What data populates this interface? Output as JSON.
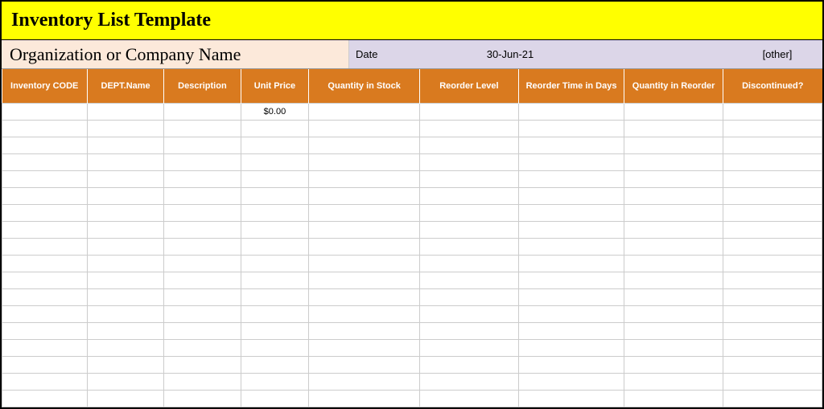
{
  "title": "Inventory List Template",
  "info": {
    "org_label": "Organization  or Company Name",
    "date_label": "Date",
    "date_value": "30-Jun-21",
    "other": "[other]"
  },
  "columns": [
    "Inventory CODE",
    "DEPT.Name",
    "Description",
    "Unit Price",
    "Quantity in Stock",
    "Reorder Level",
    "Reorder Time in Days",
    "Quantity in Reorder",
    "Discontinued?"
  ],
  "rows": [
    [
      "",
      "",
      "",
      "$0.00",
      "",
      "",
      "",
      "",
      ""
    ],
    [
      "",
      "",
      "",
      "",
      "",
      "",
      "",
      "",
      ""
    ],
    [
      "",
      "",
      "",
      "",
      "",
      "",
      "",
      "",
      ""
    ],
    [
      "",
      "",
      "",
      "",
      "",
      "",
      "",
      "",
      ""
    ],
    [
      "",
      "",
      "",
      "",
      "",
      "",
      "",
      "",
      ""
    ],
    [
      "",
      "",
      "",
      "",
      "",
      "",
      "",
      "",
      ""
    ],
    [
      "",
      "",
      "",
      "",
      "",
      "",
      "",
      "",
      ""
    ],
    [
      "",
      "",
      "",
      "",
      "",
      "",
      "",
      "",
      ""
    ],
    [
      "",
      "",
      "",
      "",
      "",
      "",
      "",
      "",
      ""
    ],
    [
      "",
      "",
      "",
      "",
      "",
      "",
      "",
      "",
      ""
    ],
    [
      "",
      "",
      "",
      "",
      "",
      "",
      "",
      "",
      ""
    ],
    [
      "",
      "",
      "",
      "",
      "",
      "",
      "",
      "",
      ""
    ],
    [
      "",
      "",
      "",
      "",
      "",
      "",
      "",
      "",
      ""
    ],
    [
      "",
      "",
      "",
      "",
      "",
      "",
      "",
      "",
      ""
    ],
    [
      "",
      "",
      "",
      "",
      "",
      "",
      "",
      "",
      ""
    ],
    [
      "",
      "",
      "",
      "",
      "",
      "",
      "",
      "",
      ""
    ],
    [
      "",
      "",
      "",
      "",
      "",
      "",
      "",
      "",
      ""
    ],
    [
      "",
      "",
      "",
      "",
      "",
      "",
      "",
      "",
      ""
    ]
  ]
}
